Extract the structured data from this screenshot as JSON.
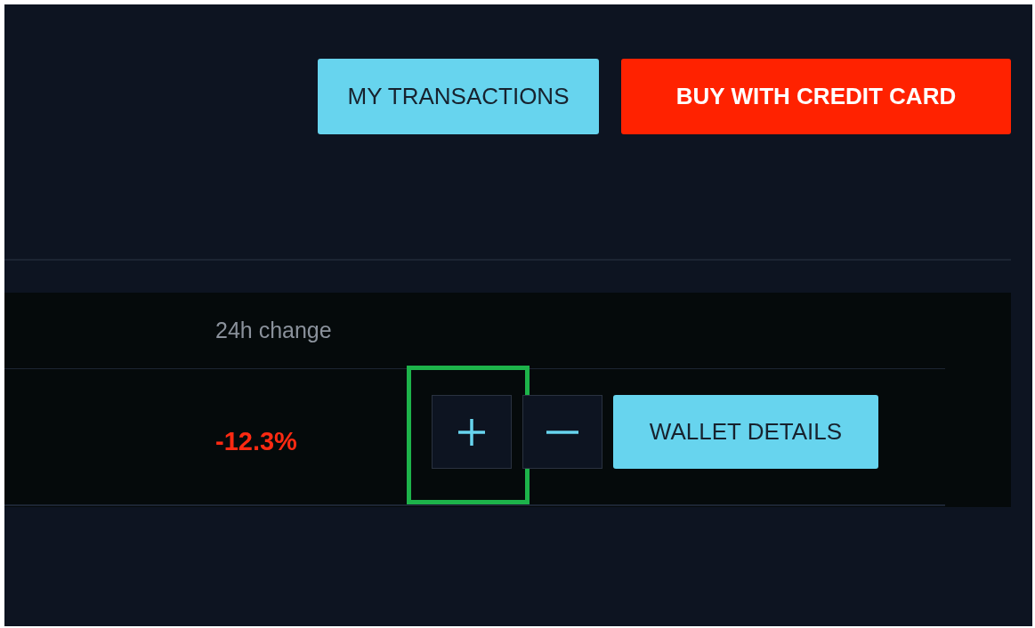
{
  "header_buttons": [
    {
      "label": "MY TRANSACTIONS",
      "kind": "secondary"
    },
    {
      "label": "BUY WITH CREDIT CARD",
      "kind": "primary"
    }
  ],
  "table": {
    "columns": [
      "24h change"
    ],
    "rows": [
      {
        "change": "-12.3%",
        "negative": true,
        "actions": [
          {
            "kind": "plus",
            "highlighted": true
          },
          {
            "kind": "minus",
            "highlighted": false
          },
          {
            "kind": "text",
            "label": "WALLET DETAILS",
            "highlighted": false
          }
        ]
      }
    ]
  }
}
